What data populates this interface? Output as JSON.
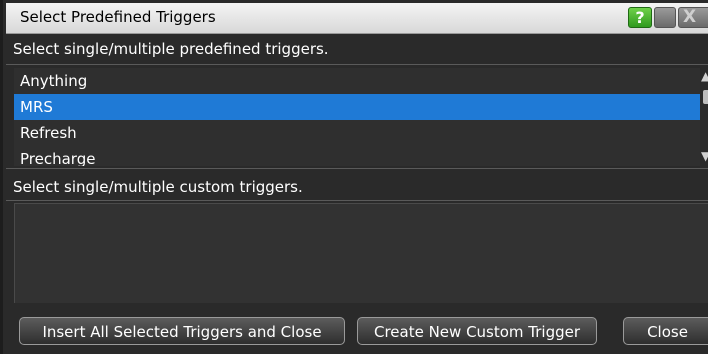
{
  "window": {
    "title": "Select Predefined Triggers",
    "help_label": "?",
    "close_label": "X"
  },
  "predefined": {
    "label": "Select single/multiple predefined triggers.",
    "items": [
      {
        "label": "Anything",
        "selected": false
      },
      {
        "label": "MRS",
        "selected": true
      },
      {
        "label": "Refresh",
        "selected": false
      },
      {
        "label": "Precharge",
        "selected": false
      }
    ],
    "scroll_up_icon": "▲",
    "scroll_down_icon": "▼"
  },
  "custom": {
    "label": "Select single/multiple custom triggers.",
    "items": []
  },
  "buttons": {
    "insert_label": "Insert All Selected Triggers and Close",
    "create_label": "Create New Custom Trigger",
    "close_label": "Close"
  },
  "colors": {
    "selection": "#1f7ad6",
    "help_button": "#3fb12a"
  }
}
